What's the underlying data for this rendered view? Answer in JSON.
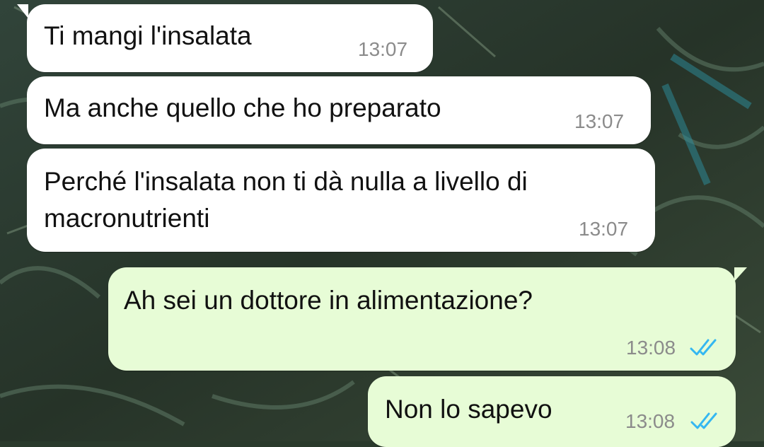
{
  "theme": {
    "incoming_bubble": "#ffffff",
    "outgoing_bubble": "#e7fcd6",
    "timestamp_color": "#8b8b8b",
    "read_tick_color": "#34b7f1",
    "wallpaper_base": "#2a3a2c"
  },
  "messages": [
    {
      "direction": "incoming",
      "text": "Ti mangi l'insalata",
      "time": "13:07"
    },
    {
      "direction": "incoming",
      "text": "Ma anche quello che ho preparato",
      "time": "13:07"
    },
    {
      "direction": "incoming",
      "text_line1": "Perché l'insalata non ti dà nulla a livello di",
      "text_line2": "macronutrienti",
      "time": "13:07"
    },
    {
      "direction": "outgoing",
      "text": "Ah sei un dottore in alimentazione?",
      "time": "13:08",
      "status": "read",
      "status_icon": "double-check-icon"
    },
    {
      "direction": "outgoing",
      "text": "Non lo sapevo",
      "time": "13:08",
      "status": "read",
      "status_icon": "double-check-icon"
    }
  ]
}
